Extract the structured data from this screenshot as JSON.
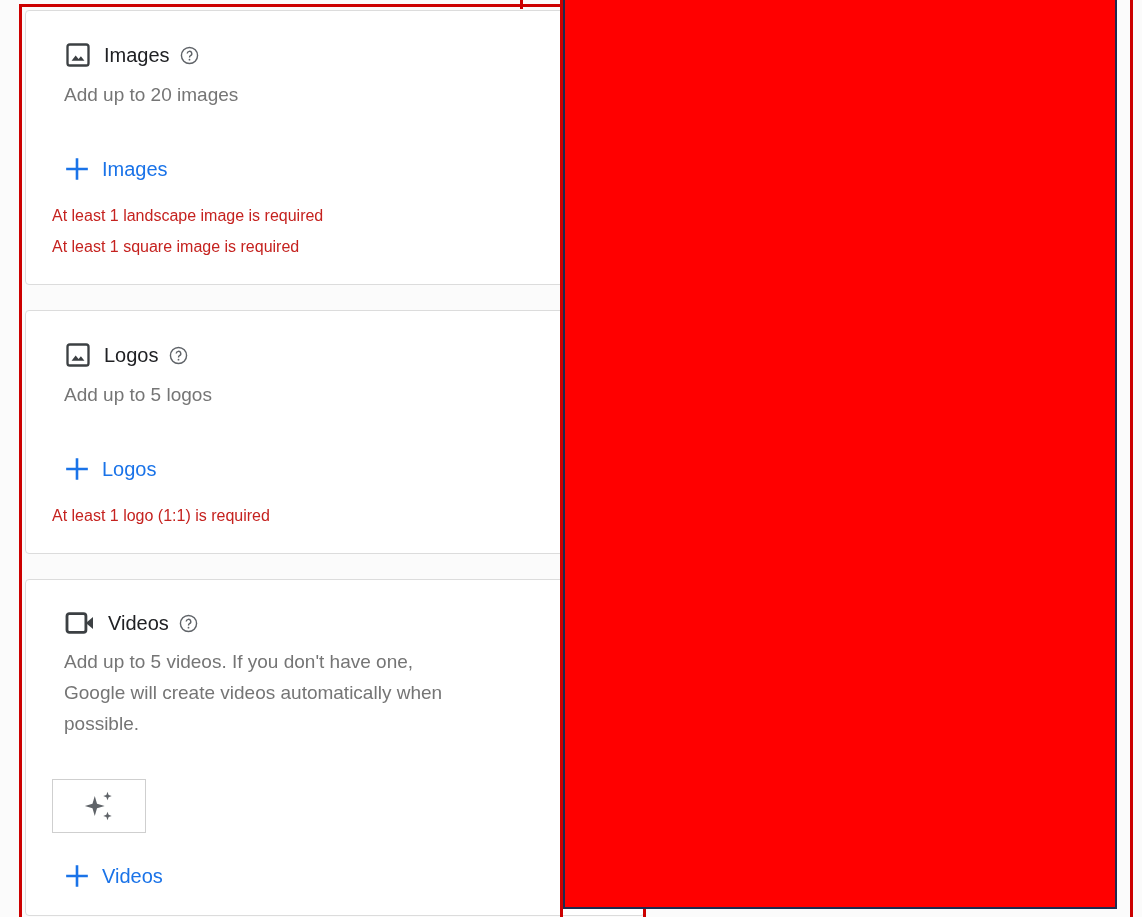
{
  "sections": [
    {
      "kind": "image",
      "title": "Images",
      "description": "Add up to 20 images",
      "add_label": "Images",
      "errors": [
        "At least 1 landscape image is required",
        "At least 1 square image is required"
      ]
    },
    {
      "kind": "image",
      "title": "Logos",
      "description": "Add up to 5 logos",
      "add_label": "Logos",
      "errors": [
        "At least 1 logo (1:1) is required"
      ]
    },
    {
      "kind": "video",
      "title": "Videos",
      "description": "Add up to 5 videos. If you don't have one, Google will create videos automatically when possible.",
      "add_label": "Videos"
    }
  ],
  "redacted": true
}
